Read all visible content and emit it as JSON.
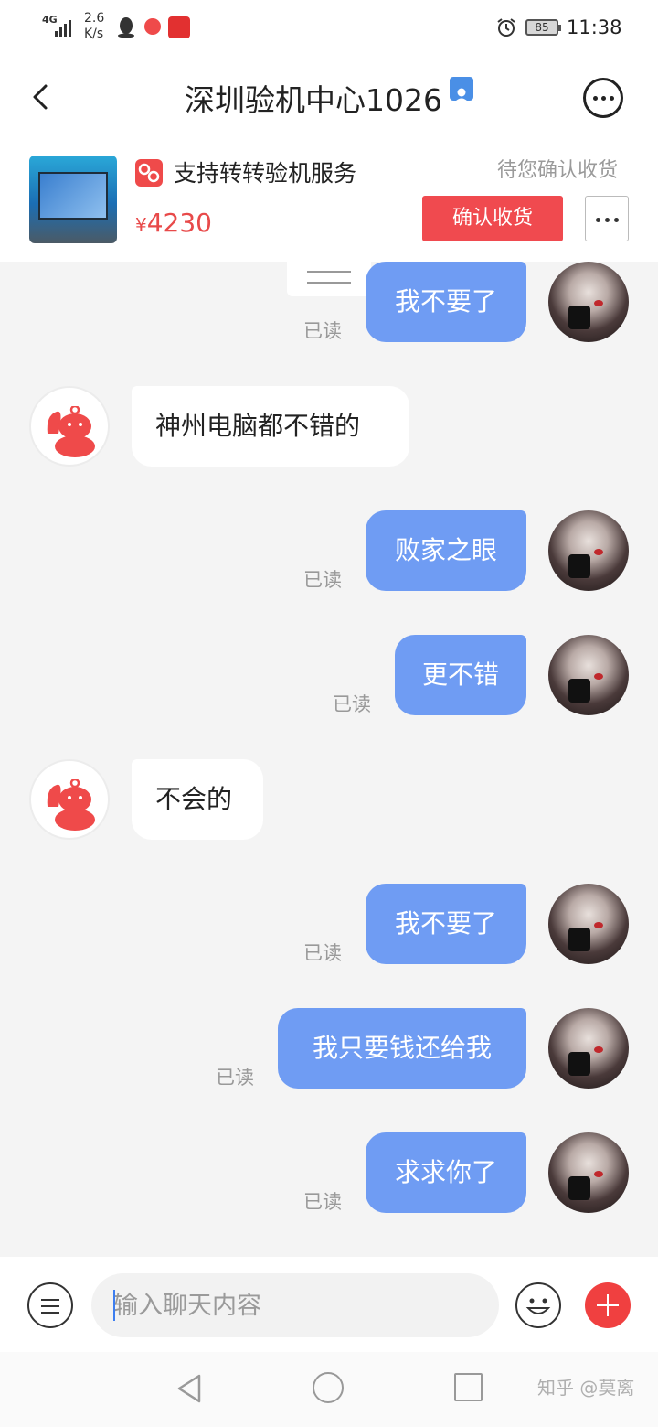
{
  "status_bar": {
    "network": "4G",
    "speed_value": "2.6",
    "speed_unit": "K/s",
    "battery": "85",
    "time": "11:38"
  },
  "header": {
    "title": "深圳验机中心1026"
  },
  "product": {
    "service_label": "支持转转验机服务",
    "price": "4230",
    "currency": "¥",
    "status": "待您确认收货",
    "confirm_label": "确认收货"
  },
  "messages": [
    {
      "from": "me",
      "text": "我不要了",
      "read": "已读"
    },
    {
      "from": "them",
      "text": "神州电脑都不错的"
    },
    {
      "from": "me",
      "text": "败家之眼",
      "read": "已读"
    },
    {
      "from": "me",
      "text": "更不错",
      "read": "已读"
    },
    {
      "from": "them",
      "text": "不会的"
    },
    {
      "from": "me",
      "text": "我不要了",
      "read": "已读"
    },
    {
      "from": "me",
      "text": "我只要钱还给我",
      "read": "已读"
    },
    {
      "from": "me",
      "text": "求求你了",
      "read": "已读"
    }
  ],
  "input": {
    "placeholder": "输入聊天内容"
  },
  "watermark": "知乎 @莫离",
  "colors": {
    "accent_red": "#f04a4f",
    "my_bubble": "#6f9cf3",
    "price_red": "#e84a4a"
  }
}
